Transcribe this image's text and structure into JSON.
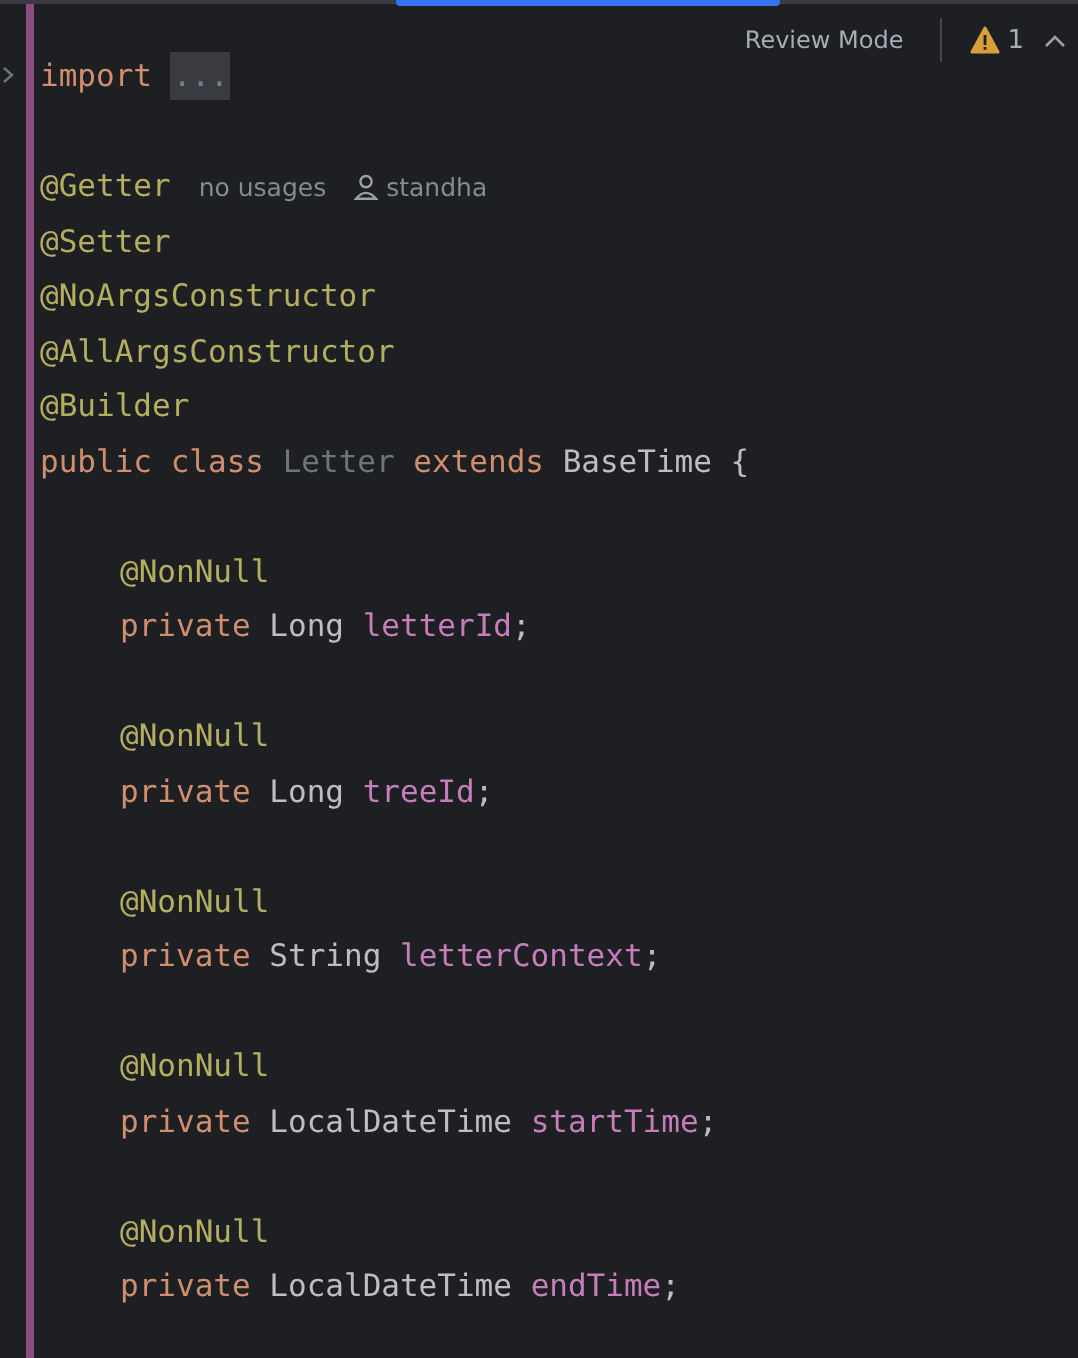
{
  "toolbar": {
    "mode": "Review Mode",
    "warnings": "1"
  },
  "lines": [
    {
      "kind": "code",
      "tokens": [
        {
          "kind": "keyword",
          "text": "import "
        },
        {
          "kind": "folded",
          "text": "..."
        }
      ]
    },
    {
      "kind": "blank"
    },
    {
      "kind": "code",
      "tokens": [
        {
          "kind": "annotation",
          "text": "@Getter"
        }
      ],
      "hints": [
        {
          "kind": "usages",
          "text": "no usages"
        },
        {
          "kind": "author",
          "text": "standha"
        }
      ]
    },
    {
      "kind": "code",
      "tokens": [
        {
          "kind": "annotation",
          "text": "@Setter"
        }
      ]
    },
    {
      "kind": "code",
      "tokens": [
        {
          "kind": "annotation",
          "text": "@NoArgsConstructor"
        }
      ]
    },
    {
      "kind": "code",
      "tokens": [
        {
          "kind": "annotation",
          "text": "@AllArgsConstructor"
        }
      ]
    },
    {
      "kind": "code",
      "tokens": [
        {
          "kind": "annotation",
          "text": "@Builder"
        }
      ]
    },
    {
      "kind": "code",
      "tokens": [
        {
          "kind": "keyword",
          "text": "public class "
        },
        {
          "kind": "unused",
          "text": "Letter "
        },
        {
          "kind": "keyword",
          "text": "extends "
        },
        {
          "kind": "type",
          "text": "BaseTime {"
        }
      ],
      "children": [
        {
          "kind": "blank"
        },
        {
          "kind": "code",
          "tokens": [
            {
              "kind": "annotation",
              "text": "@NonNull"
            }
          ]
        },
        {
          "kind": "code",
          "tokens": [
            {
              "kind": "keyword",
              "text": "private "
            },
            {
              "kind": "type",
              "text": "Long "
            },
            {
              "kind": "field",
              "text": "letterId"
            },
            {
              "kind": "plain",
              "text": ";"
            }
          ]
        },
        {
          "kind": "blank"
        },
        {
          "kind": "code",
          "tokens": [
            {
              "kind": "annotation",
              "text": "@NonNull"
            }
          ]
        },
        {
          "kind": "code",
          "tokens": [
            {
              "kind": "keyword",
              "text": "private "
            },
            {
              "kind": "type",
              "text": "Long "
            },
            {
              "kind": "field",
              "text": "treeId"
            },
            {
              "kind": "plain",
              "text": ";"
            }
          ]
        },
        {
          "kind": "blank"
        },
        {
          "kind": "code",
          "tokens": [
            {
              "kind": "annotation",
              "text": "@NonNull"
            }
          ]
        },
        {
          "kind": "code",
          "tokens": [
            {
              "kind": "keyword",
              "text": "private "
            },
            {
              "kind": "type",
              "text": "String "
            },
            {
              "kind": "field",
              "text": "letterContext"
            },
            {
              "kind": "plain",
              "text": ";"
            }
          ]
        },
        {
          "kind": "blank"
        },
        {
          "kind": "code",
          "tokens": [
            {
              "kind": "annotation",
              "text": "@NonNull"
            }
          ]
        },
        {
          "kind": "code",
          "tokens": [
            {
              "kind": "keyword",
              "text": "private "
            },
            {
              "kind": "type",
              "text": "LocalDateTime "
            },
            {
              "kind": "field",
              "text": "startTime"
            },
            {
              "kind": "plain",
              "text": ";"
            }
          ]
        },
        {
          "kind": "blank"
        },
        {
          "kind": "code",
          "tokens": [
            {
              "kind": "annotation",
              "text": "@NonNull"
            }
          ]
        },
        {
          "kind": "code",
          "tokens": [
            {
              "kind": "keyword",
              "text": "private "
            },
            {
              "kind": "type",
              "text": "LocalDateTime "
            },
            {
              "kind": "field",
              "text": "endTime"
            },
            {
              "kind": "plain",
              "text": ";"
            }
          ]
        },
        {
          "kind": "blank"
        }
      ]
    }
  ]
}
